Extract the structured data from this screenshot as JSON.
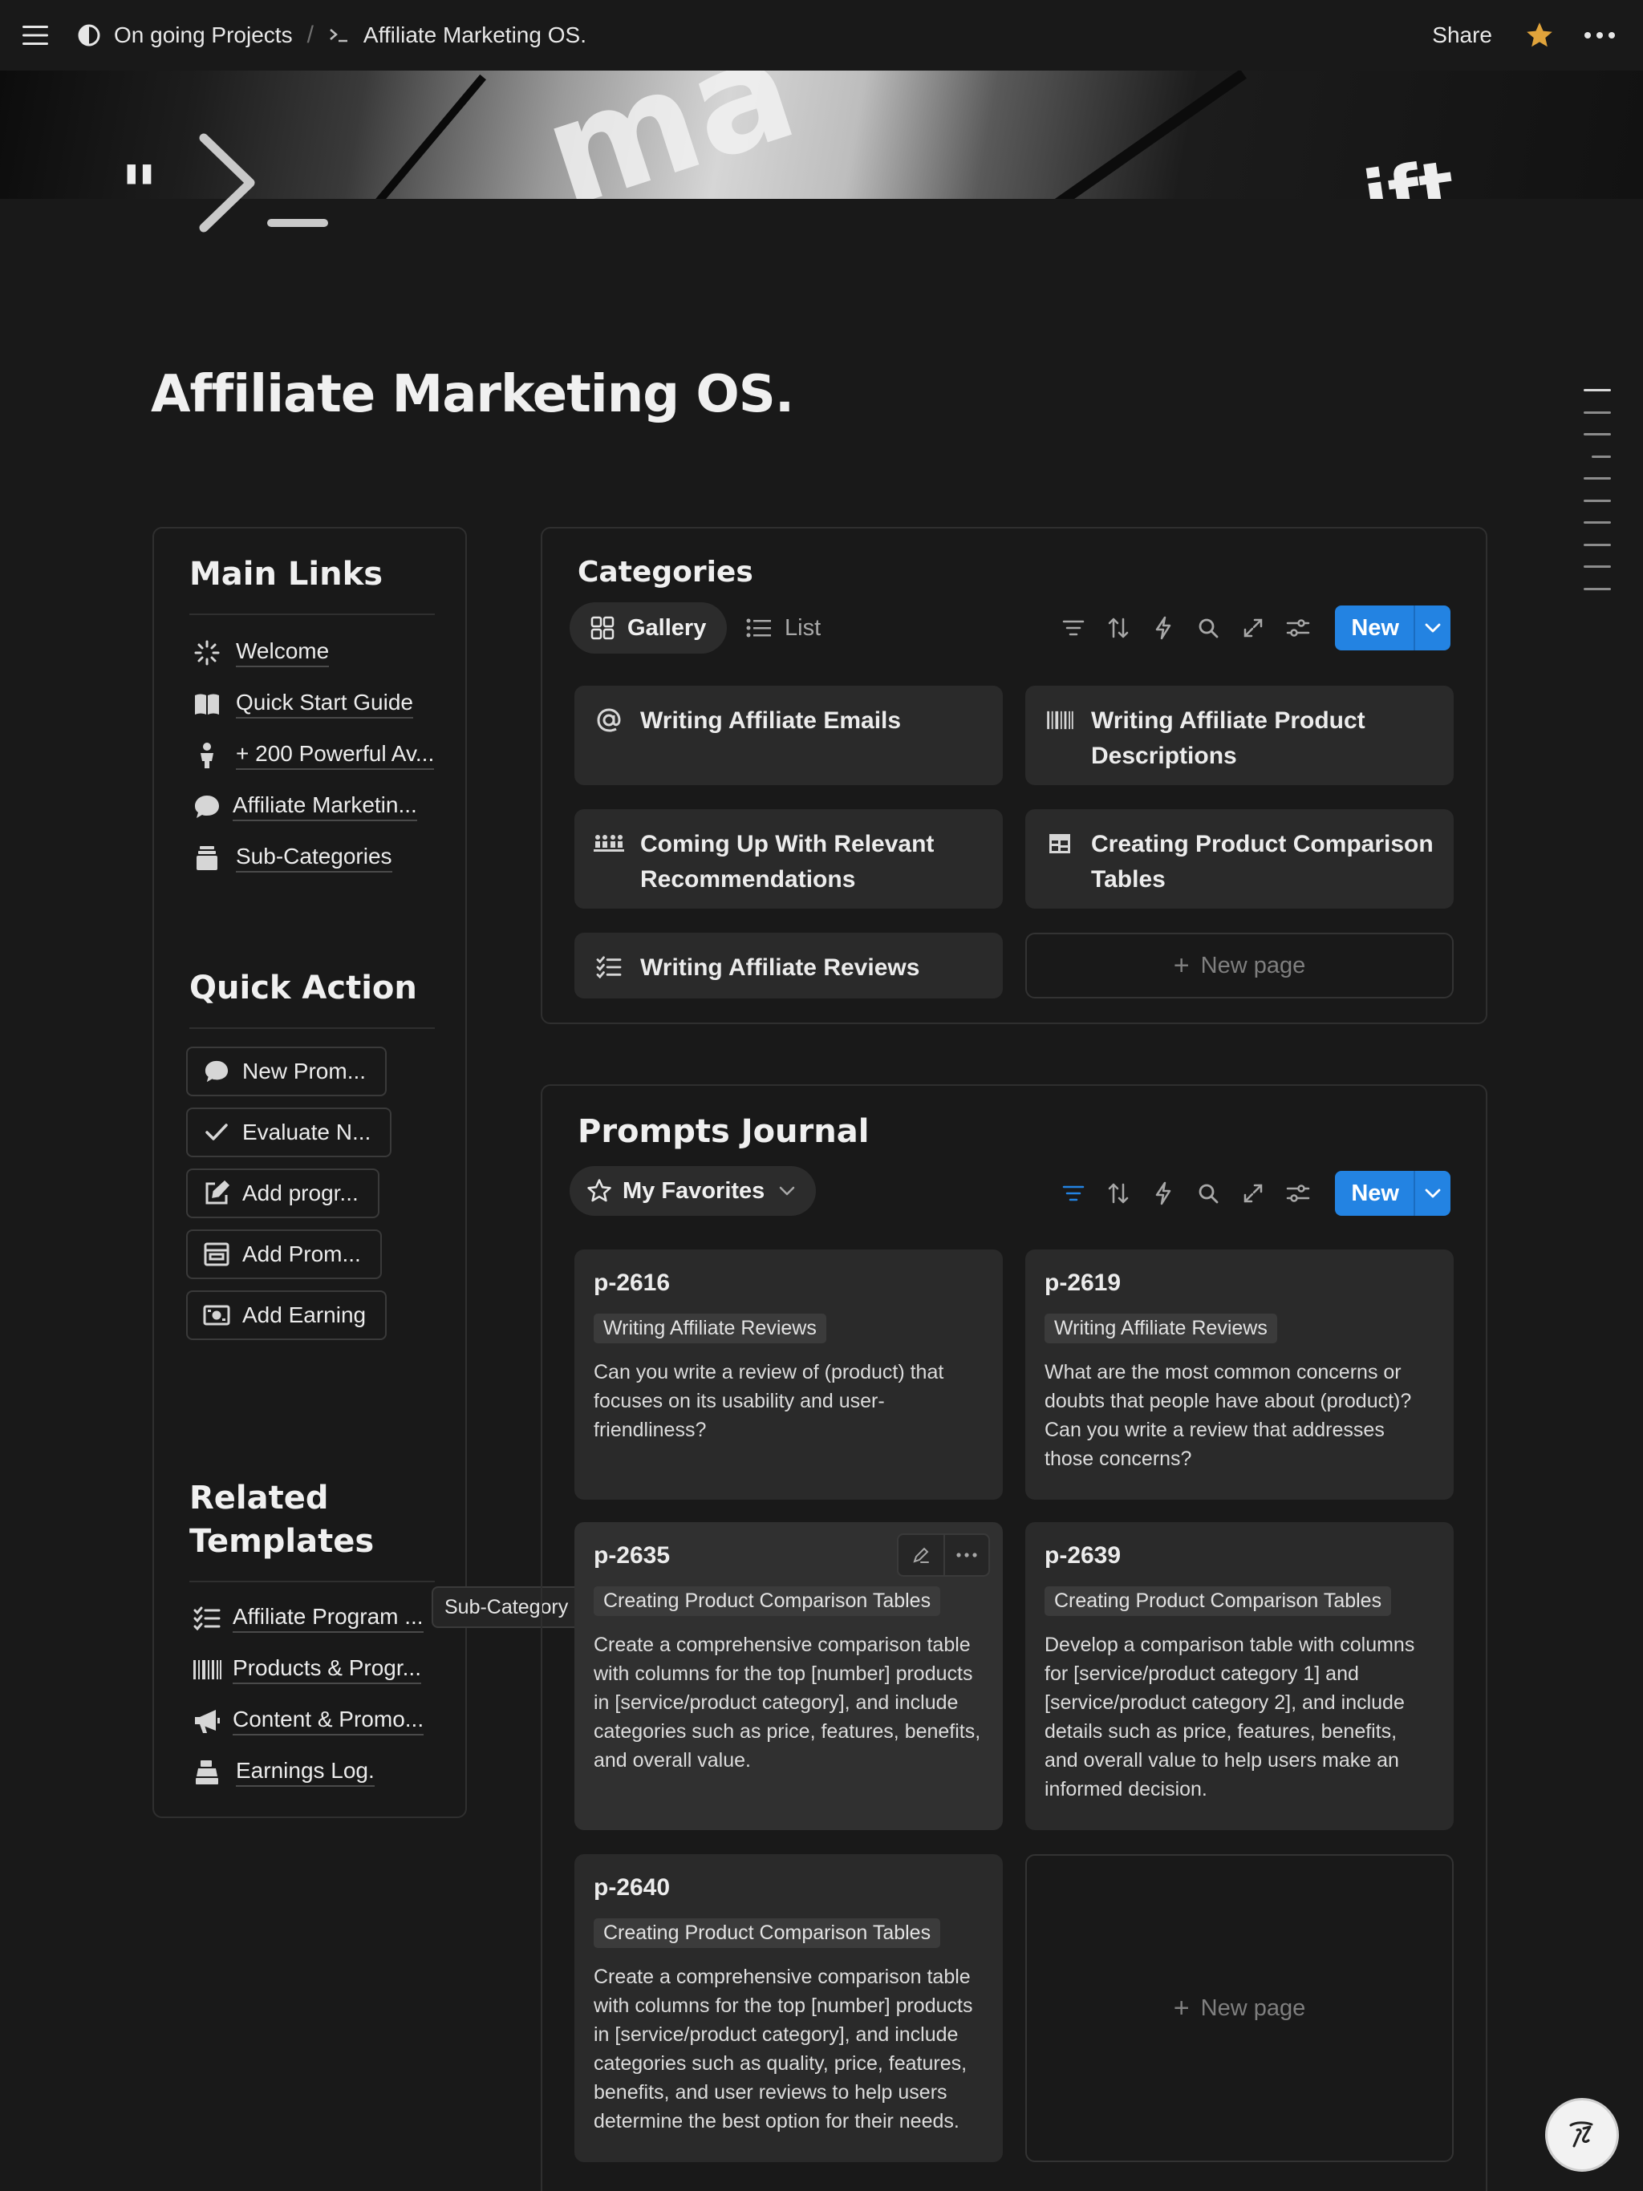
{
  "topbar": {
    "breadcrumbs": [
      {
        "label": "On going Projects",
        "icon": "contrast-icon"
      },
      {
        "label": "Affiliate Marketing OS.",
        "icon": "terminal-icon"
      }
    ],
    "separator": "/",
    "share_label": "Share",
    "favorite_color": "#e1a43b"
  },
  "page": {
    "title": "Affiliate Marketing OS.",
    "icon": "terminal-icon"
  },
  "sidebar": {
    "main_links": {
      "title": "Main Links",
      "items": [
        {
          "label": "Welcome",
          "icon": "sparkle-icon"
        },
        {
          "label": "Quick Start Guide",
          "icon": "book-icon"
        },
        {
          "label": "+ 200 Powerful Av...",
          "icon": "person-icon"
        },
        {
          "label": "Affiliate Marketin...",
          "icon": "chat-bubble-icon"
        },
        {
          "label": "Sub-Categories",
          "icon": "archive-icon"
        }
      ]
    },
    "quick_action": {
      "title": "Quick Action",
      "buttons": [
        {
          "label": "New Prom...",
          "icon": "chat-bubble-icon"
        },
        {
          "label": "Evaluate N...",
          "icon": "check-icon"
        },
        {
          "label": "Add progr...",
          "icon": "edit-icon"
        },
        {
          "label": "Add Prom...",
          "icon": "form-icon"
        },
        {
          "label": "Add Earning",
          "icon": "money-icon"
        }
      ]
    },
    "related_templates": {
      "title": "Related Templates",
      "items": [
        {
          "label": "Affiliate Program ...",
          "icon": "checklist-icon"
        },
        {
          "label": "Products & Progr...",
          "icon": "barcode-icon"
        },
        {
          "label": "Content & Promo...",
          "icon": "megaphone-icon"
        },
        {
          "label": "Earnings Log.",
          "icon": "cash-register-icon"
        }
      ]
    },
    "tooltip": "Sub-Category"
  },
  "categories": {
    "title": "Categories",
    "tabs": [
      {
        "label": "Gallery",
        "icon": "gallery-icon",
        "active": true
      },
      {
        "label": "List",
        "icon": "list-icon",
        "active": false
      }
    ],
    "new_label": "New",
    "cards": [
      {
        "label": "Writing Affiliate Emails",
        "icon": "at-icon"
      },
      {
        "label": "Writing Affiliate Product Descriptions",
        "icon": "barcode-icon"
      },
      {
        "label": "Coming Up With Relevant Recommendations",
        "icon": "group-icon"
      },
      {
        "label": "Creating Product Comparison Tables",
        "icon": "table-icon"
      },
      {
        "label": "Writing Affiliate Reviews",
        "icon": "checklist-icon"
      }
    ],
    "new_page_label": "New page"
  },
  "prompts": {
    "title": "Prompts Journal",
    "view_label": "My Favorites",
    "new_label": "New",
    "accent": "#2383e2",
    "cards": [
      {
        "id": "p-2616",
        "tag": "Writing Affiliate Reviews",
        "text": "Can you write a review of (product) that focuses on its usability and user-friendliness?"
      },
      {
        "id": "p-2619",
        "tag": "Writing Affiliate Reviews",
        "text": "What are the most common concerns or doubts that people have about (product)? Can you write a review that addresses those concerns?"
      },
      {
        "id": "p-2635",
        "tag": "Creating Product Comparison Tables",
        "text": "Create a comprehensive comparison table with columns for the top [number] products in [service/product category], and include categories such as price, features, benefits, and overall value."
      },
      {
        "id": "p-2639",
        "tag": "Creating Product Comparison Tables",
        "text": "Develop a comparison table with columns for [service/product category 1] and [service/product category 2], and include details such as price, features, benefits, and overall value to help users make an informed decision."
      },
      {
        "id": "p-2640",
        "tag": "Creating Product Comparison Tables",
        "text": "Create a comprehensive comparison table with columns for the top [number] products in [service/product category], and include categories such as quality, price, features, benefits, and user reviews to help users determine the best option for their needs."
      }
    ],
    "new_page_label": "New page"
  }
}
